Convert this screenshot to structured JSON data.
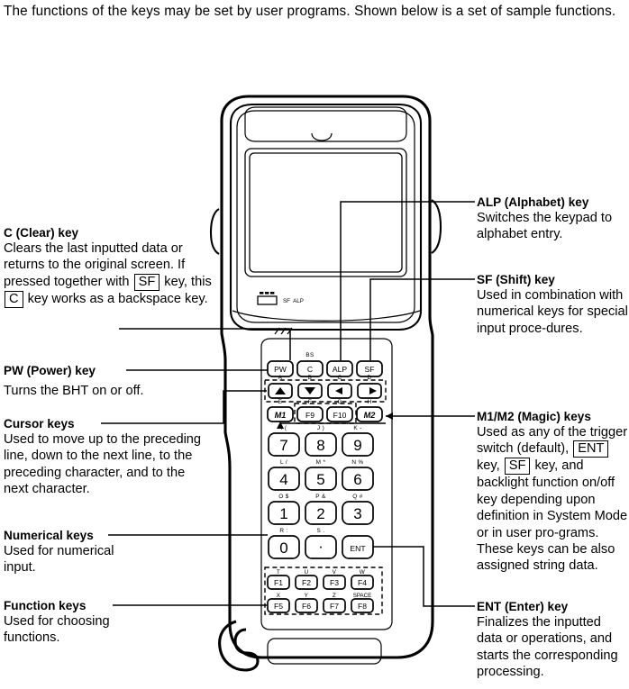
{
  "intro": {
    "text": "The functions of the keys may be set by user programs.  Shown below is a set of sample functions."
  },
  "annotations_left": [
    {
      "id": "c-clear",
      "title": "C (Clear) key",
      "body_part1": "Clears the last inputted data or returns to the original screen.  If pressed together with ",
      "inline_key1": "SF",
      "body_part2": " key, this ",
      "inline_key2": "C",
      "body_part3": " key works as a backspace key."
    },
    {
      "id": "pw-power",
      "title": "PW (Power) key",
      "body": "Turns the BHT on or off."
    },
    {
      "id": "cursor-keys",
      "title": "Cursor keys",
      "body": "Used to move up to the preceding line, down to the next line, to the preceding character, and to the next character."
    },
    {
      "id": "numerical-keys",
      "title": "Numerical keys",
      "body": "Used for numerical input."
    },
    {
      "id": "function-keys",
      "title": "Function keys",
      "body": "Used for choosing functions."
    }
  ],
  "annotations_right": [
    {
      "id": "alp-alphabet",
      "title": "ALP (Alphabet) key",
      "body": "Switches the keypad to alphabet entry."
    },
    {
      "id": "sf-shift",
      "title": "SF (Shift) key",
      "body": "Used in combination with numerical keys for special input proce-dures."
    },
    {
      "id": "m1m2-magic",
      "title": "M1/M2 (Magic) keys",
      "body_part1": "Used as any of the trigger switch (default), ",
      "inline_key1": "ENT",
      "body_part2": " key, ",
      "inline_key2": "SF",
      "body_part3": " key, and backlight function on/off key depending upon definition in System Mode or in user pro-grams.  These keys can be also assigned string data."
    },
    {
      "id": "ent-enter",
      "title": "ENT (Enter) key",
      "body": "Finalizes the inputted data or operations, and starts the corresponding processing."
    }
  ],
  "device": {
    "display_indicators": [
      "SF",
      "ALP"
    ],
    "keys": {
      "row_top": [
        {
          "label": "PW",
          "sup": ""
        },
        {
          "label": "C",
          "sup": "BS"
        },
        {
          "label": "ALP",
          "sup": ""
        },
        {
          "label": "SF",
          "sup": ""
        }
      ],
      "row_cursor": [
        {
          "label": "▲",
          "sup": "A"
        },
        {
          "label": "▼",
          "sup": "B"
        },
        {
          "label": "◀",
          "sup": "C"
        },
        {
          "label": "▶",
          "sup": "D"
        }
      ],
      "row_magic": [
        {
          "label": "M1",
          "sup": "E"
        },
        {
          "label": "F9",
          "sup": "F"
        },
        {
          "label": "F10",
          "sup": "G"
        },
        {
          "label": "M2",
          "sup": "H"
        }
      ],
      "numeric": [
        {
          "label": "7",
          "sup": "I  ("
        },
        {
          "label": "8",
          "sup": "J  )"
        },
        {
          "label": "9",
          "sup": "K  -"
        },
        {
          "label": "4",
          "sup": "L  /"
        },
        {
          "label": "5",
          "sup": "M  *"
        },
        {
          "label": "6",
          "sup": "N  %"
        },
        {
          "label": "1",
          "sup": "O  $"
        },
        {
          "label": "2",
          "sup": "P  &"
        },
        {
          "label": "3",
          "sup": "Q  #"
        },
        {
          "label": "0",
          "sup": "R  :"
        },
        {
          "label": "·",
          "sup": "S  ."
        },
        {
          "label": "ENT",
          "sup": ""
        }
      ],
      "function_row1": [
        {
          "label": "F1",
          "sup": "T"
        },
        {
          "label": "F2",
          "sup": "U"
        },
        {
          "label": "F3",
          "sup": "V"
        },
        {
          "label": "F4",
          "sup": "W"
        }
      ],
      "function_row2": [
        {
          "label": "F5",
          "sup": "X"
        },
        {
          "label": "F6",
          "sup": "Y"
        },
        {
          "label": "F7",
          "sup": "Z"
        },
        {
          "label": "F8",
          "sup": "SPACE"
        }
      ]
    }
  },
  "colors": {
    "ink": "#000000",
    "paper": "#ffffff"
  }
}
